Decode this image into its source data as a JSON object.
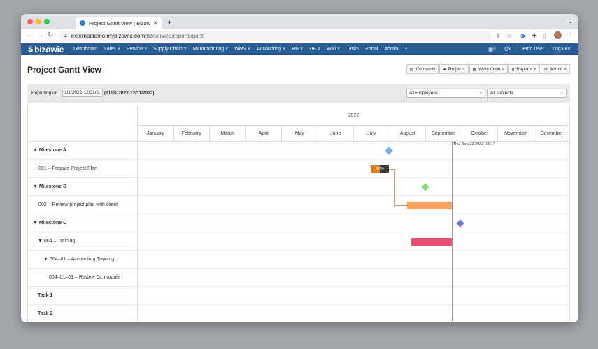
{
  "browser": {
    "tab_title": "Project Gantt View | Bizowie E",
    "url_host": "externaldemo.mybizowie.com",
    "url_path": "/bz/service/reports/gantt"
  },
  "nav": {
    "brand": "bizowie",
    "items": [
      "Dashboard",
      "Sales ˅",
      "Service ˅",
      "Supply Chain ˅",
      "Manufacturing ˅",
      "WMS ˅",
      "Accounting ˅",
      "HR ˅",
      "DB ˅",
      "Wiki ˅",
      "Tasks",
      "Portal",
      "Admin"
    ],
    "user": "Demo User",
    "logout": "Log Out"
  },
  "page": {
    "title": "Project Gantt View",
    "buttons": {
      "contracts": "Contracts",
      "projects": "Projects",
      "work_orders": "Work Orders",
      "reports": "Reports ˅",
      "admin": "Admin ˅"
    }
  },
  "filters": {
    "label": "Reporting on",
    "date_range_value": "1/1/2022-12/31/2",
    "date_range_text": "(01/01/2022-12/31/2022)",
    "employees_value": "All Employees",
    "projects_value": "All Projects"
  },
  "gantt": {
    "year": "2022",
    "months": [
      "January",
      "February",
      "March",
      "April",
      "May",
      "June",
      "July",
      "August",
      "September",
      "October",
      "November",
      "December"
    ],
    "today_label": "Thu, Sep 22 2022, 15:17",
    "today_month_fraction": 8.71,
    "rows": [
      {
        "label": "▼ Milestone A",
        "bold": true,
        "indent": 0
      },
      {
        "label": "001 – Prepare Project Plan",
        "bold": false,
        "indent": 1
      },
      {
        "label": "▼ Milestone B",
        "bold": true,
        "indent": 0
      },
      {
        "label": "002 – Review project plan with client",
        "bold": false,
        "indent": 1
      },
      {
        "label": "▼ Milestone C",
        "bold": true,
        "indent": 0
      },
      {
        "label": "▼ 004 – Training",
        "bold": false,
        "indent": 2
      },
      {
        "label": "▼ 004–01 – Accounting Training",
        "bold": false,
        "indent": 3
      },
      {
        "label": "004–01–01 – Review GL module",
        "bold": false,
        "indent": 4
      },
      {
        "label": "Task 1",
        "bold": true,
        "indent": 2
      },
      {
        "label": "Task 2",
        "bold": true,
        "indent": 2
      }
    ],
    "task_001_progress": "50%",
    "colors": {
      "milestone_a": "#6fb0ea",
      "milestone_b": "#7ddb7a",
      "milestone_c": "#6d79d6",
      "task_002": "#f4a461",
      "task_004": "#e94b72",
      "progress_done": "#dc7c23",
      "brand_nav": "#2a5d93"
    }
  }
}
